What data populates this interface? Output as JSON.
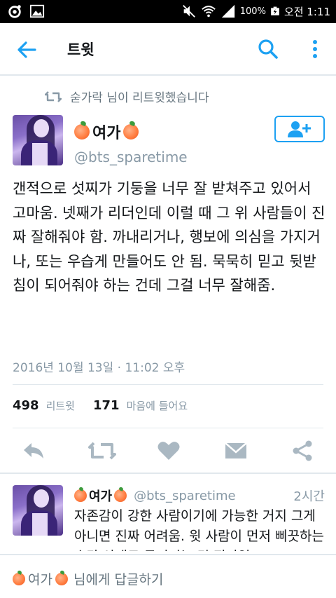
{
  "status_bar": {
    "battery": "100%",
    "time": "오전 1:11"
  },
  "app_bar": {
    "title": "트윗"
  },
  "retweet_context": {
    "text": "숟가락 님이 리트윗했습니다"
  },
  "tweet": {
    "author_name": "여가",
    "author_handle": "@bts_sparetime",
    "text": "갠적으로 섯찌가 기둥을 너무 잘 받쳐주고 있어서 고마움. 넷째가 리더인데 이럴 때 그 위 사람들이 진짜 잘해줘야 함. 까내리거나, 행보에 의심을 가지거나, 또는 우습게 만들어도 안 됨. 묵묵히 믿고 뒷받침이 되어줘야 하는 건데 그걸 너무 잘해줌.",
    "timestamp": "2016년 10월 13일 · 11:02 오후",
    "retweets_count": "498",
    "retweets_label": "리트윗",
    "likes_count": "171",
    "likes_label": "마음에 들어요"
  },
  "reply": {
    "author_name": "여가",
    "author_handle": "@bts_sparetime",
    "time": "2시간",
    "text": "자존감이 강한 사람이기에 가능한 거지 그게 아니면 진짜 어려움. 윗 사람이 먼저 삐끗하는 순간 아래로 무너지는 건 진짜임"
  },
  "reply_bar": {
    "name": "여가",
    "suffix": "님에게 답글하기"
  },
  "colors": {
    "accent": "#1da1f2",
    "icon_gray": "#aab8c2",
    "muted_text": "#8899a6"
  }
}
